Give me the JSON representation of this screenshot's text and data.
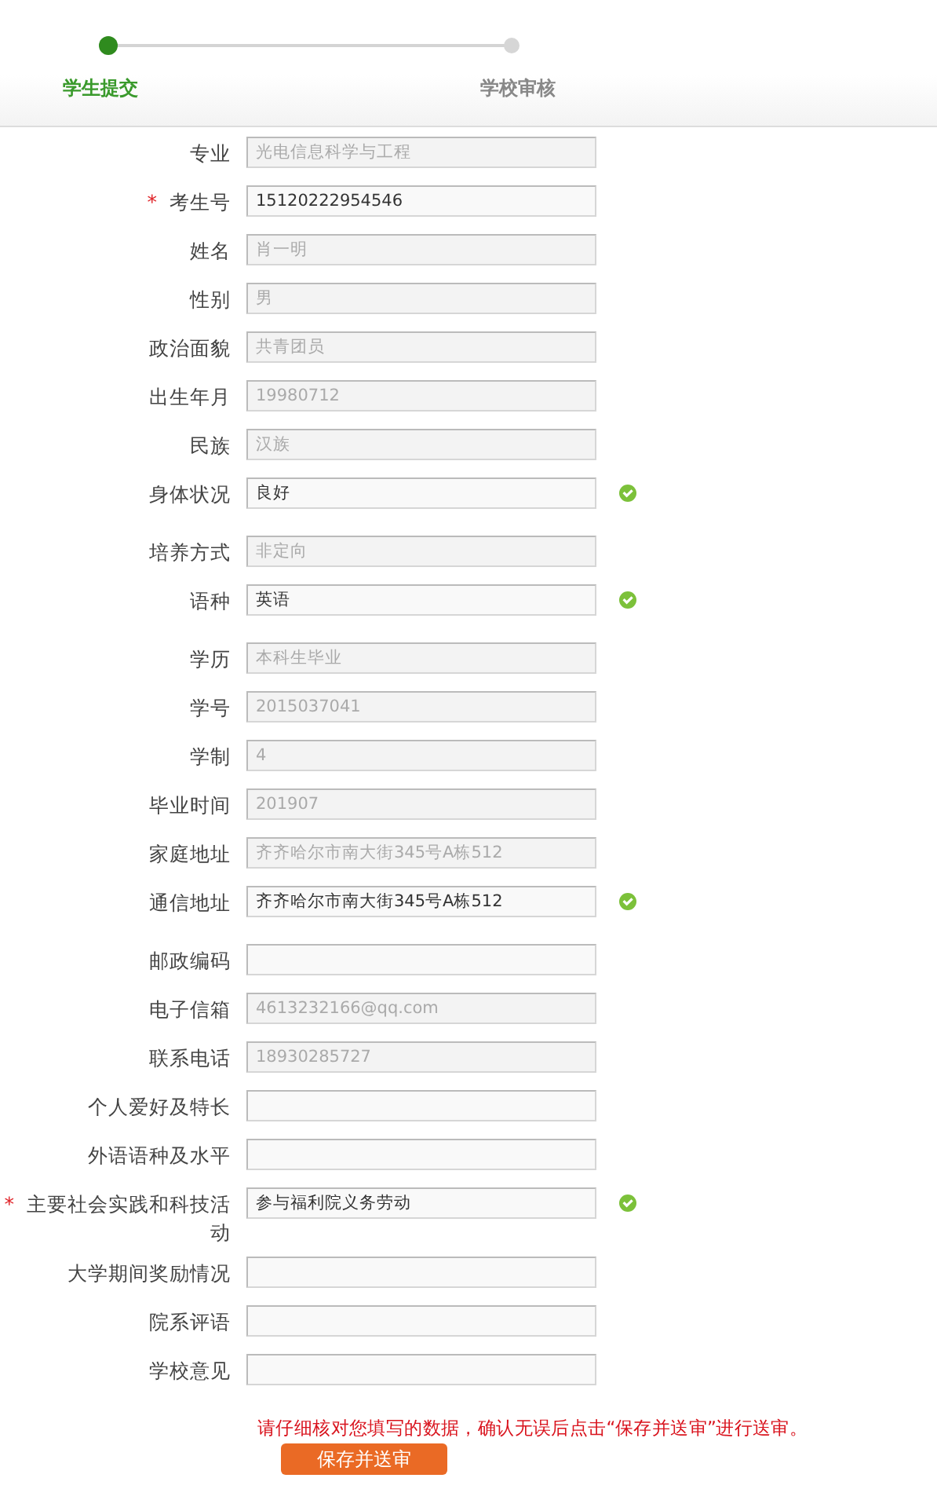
{
  "steps": [
    {
      "label": "学生提交",
      "active": true
    },
    {
      "label": "学校审核",
      "active": false
    }
  ],
  "fields": [
    {
      "label": "专业",
      "value": "光电信息科学与工程",
      "required": false,
      "readonly": true,
      "valid": false
    },
    {
      "label": "考生号",
      "value": "15120222954546",
      "required": true,
      "readonly": false,
      "valid": false
    },
    {
      "label": "姓名",
      "value": "肖一明",
      "required": false,
      "readonly": true,
      "valid": false
    },
    {
      "label": "性别",
      "value": "男",
      "required": false,
      "readonly": true,
      "valid": false
    },
    {
      "label": "政治面貌",
      "value": "共青团员",
      "required": false,
      "readonly": true,
      "valid": false
    },
    {
      "label": "出生年月",
      "value": "19980712",
      "required": false,
      "readonly": true,
      "valid": false
    },
    {
      "label": "民族",
      "value": "汉族",
      "required": false,
      "readonly": true,
      "valid": false
    },
    {
      "label": "身体状况",
      "value": "良好",
      "required": false,
      "readonly": false,
      "valid": true
    },
    {
      "label": "培养方式",
      "value": "非定向",
      "required": false,
      "readonly": true,
      "valid": false
    },
    {
      "label": "语种",
      "value": "英语",
      "required": false,
      "readonly": false,
      "valid": true
    },
    {
      "label": "学历",
      "value": "本科生毕业",
      "required": false,
      "readonly": true,
      "valid": false
    },
    {
      "label": "学号",
      "value": "2015037041",
      "required": false,
      "readonly": true,
      "valid": false
    },
    {
      "label": "学制",
      "value": "4",
      "required": false,
      "readonly": true,
      "valid": false
    },
    {
      "label": "毕业时间",
      "value": "201907",
      "required": false,
      "readonly": true,
      "valid": false
    },
    {
      "label": "家庭地址",
      "value": "齐齐哈尔市南大街345号A栋512",
      "required": false,
      "readonly": true,
      "valid": false
    },
    {
      "label": "通信地址",
      "value": "齐齐哈尔市南大街345号A栋512",
      "required": false,
      "readonly": false,
      "valid": true
    },
    {
      "label": "邮政编码",
      "required": false,
      "valid": false
    },
    {
      "label": "电子信箱",
      "value": "4613232166@qq.com",
      "required": false,
      "readonly": true,
      "valid": false
    },
    {
      "label": "联系电话",
      "value": "18930285727",
      "required": false,
      "readonly": true,
      "valid": false
    },
    {
      "label": "个人爱好及特长",
      "required": false,
      "valid": false
    },
    {
      "label": "外语语种及水平",
      "required": false,
      "valid": false
    },
    {
      "label": "主要社会实践和科技活动",
      "value": "参与福利院义务劳动",
      "required": true,
      "readonly": false,
      "valid": true
    },
    {
      "label": "大学期间奖励情况",
      "required": false,
      "valid": false
    },
    {
      "label": "院系评语",
      "required": false,
      "valid": false
    },
    {
      "label": "学校意见",
      "required": false,
      "valid": false
    }
  ],
  "required_mark": "*",
  "notice": "请仔细核对您填写的数据，确认无误后点击“保存并送审”进行送审。",
  "submit_button": "保存并送审"
}
